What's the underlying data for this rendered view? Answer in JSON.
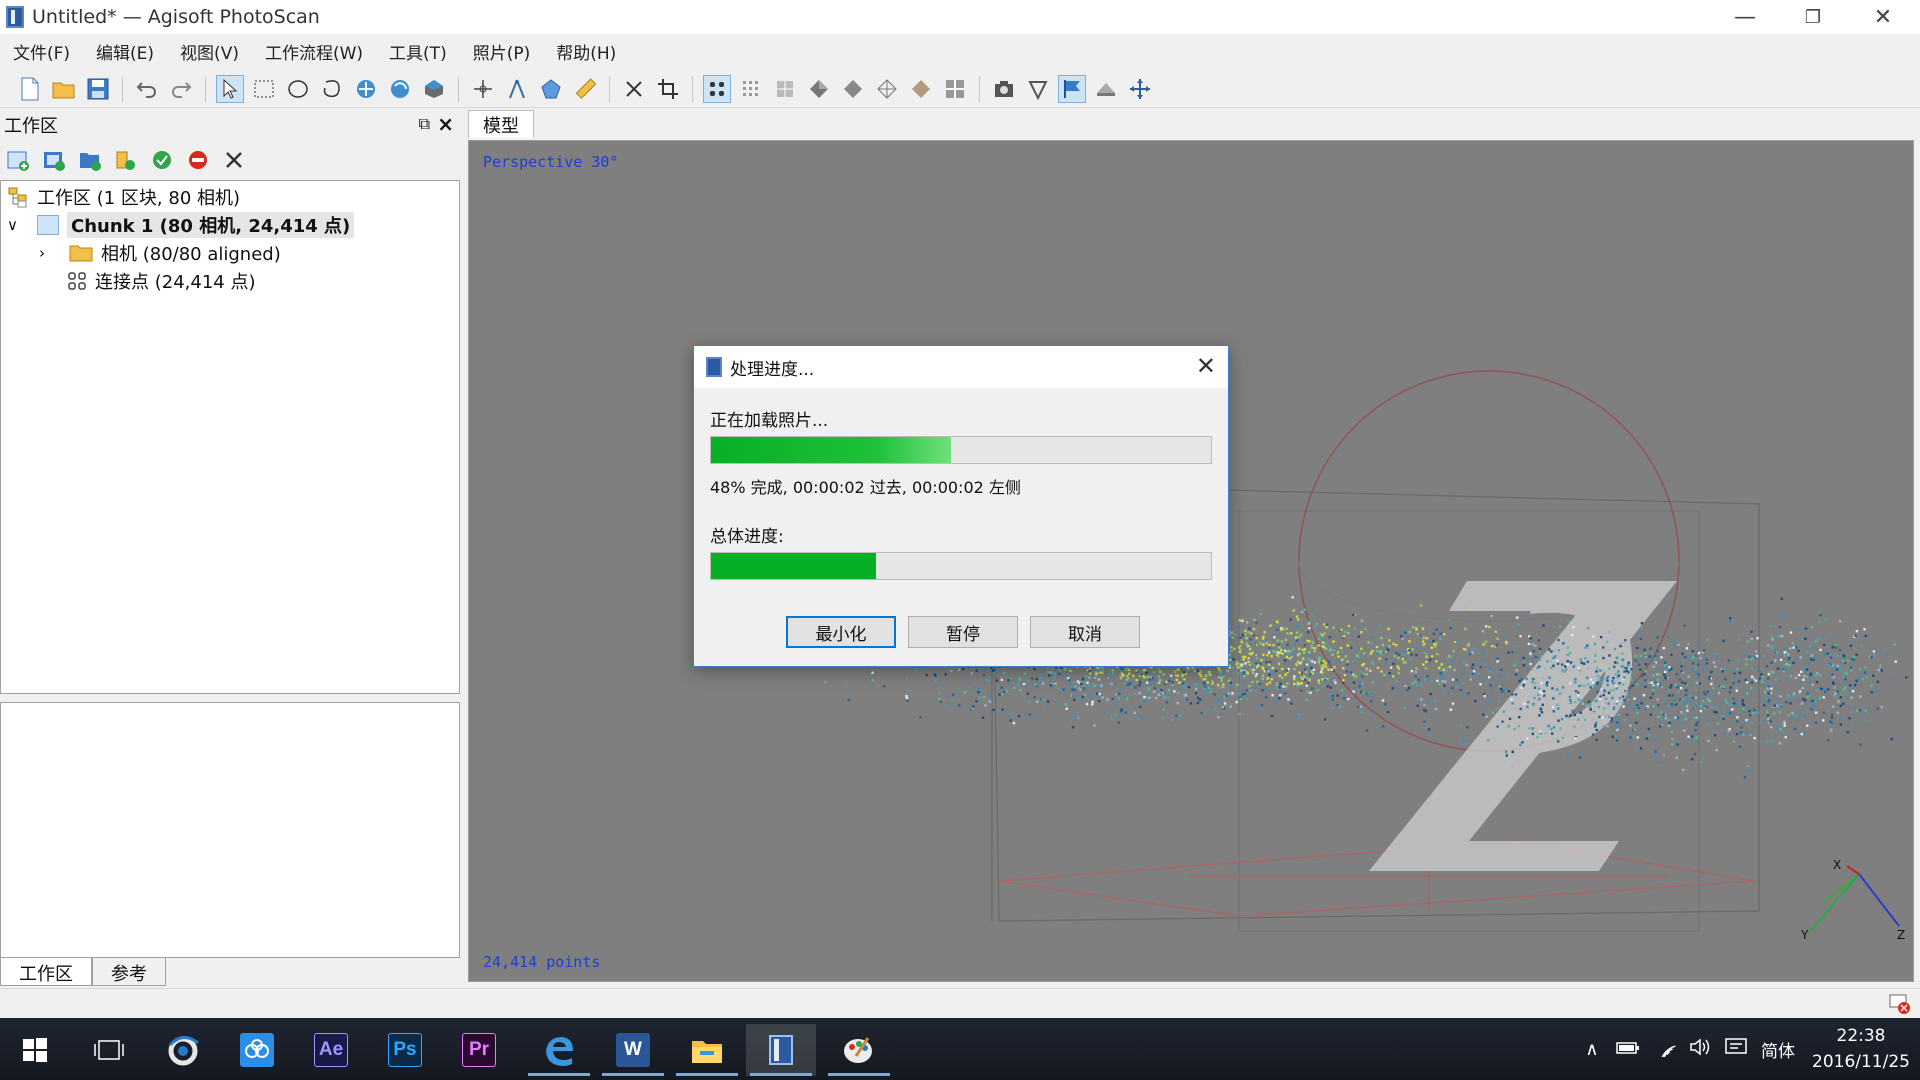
{
  "window": {
    "title": "Untitled* — Agisoft PhotoScan"
  },
  "menu": [
    "文件(F)",
    "编辑(E)",
    "视图(V)",
    "工作流程(W)",
    "工具(T)",
    "照片(P)",
    "帮助(H)"
  ],
  "workspace": {
    "title": "工作区",
    "tree": {
      "root": "工作区 (1 区块, 80 相机)",
      "chunk": "Chunk 1 (80 相机, 24,414 点)",
      "cameras": "相机 (80/80 aligned)",
      "tiepoints": "连接点 (24,414 点)"
    },
    "bottom_tabs": [
      "工作区",
      "参考"
    ]
  },
  "model": {
    "tab": "模型",
    "perspective": "Perspective 30°",
    "points": "24,414 points",
    "axes": {
      "x": "X",
      "y": "Y",
      "z": "Z"
    }
  },
  "dialog": {
    "title": "处理进度...",
    "task_label": "正在加载照片...",
    "task_progress": 0.48,
    "status": "48% 完成, 00:00:02 过去, 00:00:02 左侧",
    "overall_label": "总体进度:",
    "overall_progress": 0.33,
    "buttons": {
      "minimize": "最小化",
      "pause": "暂停",
      "cancel": "取消"
    }
  },
  "taskbar": {
    "apps": [
      "Ae",
      "Ps",
      "Pr",
      "W"
    ],
    "tray": {
      "ime": "简体",
      "time": "22:38",
      "date": "2016/11/25"
    }
  },
  "colors": {
    "accent": "#0078d7",
    "progress": "#06b025",
    "viewport": "#7f7f7f",
    "overlay_text": "#1c3fd6"
  }
}
